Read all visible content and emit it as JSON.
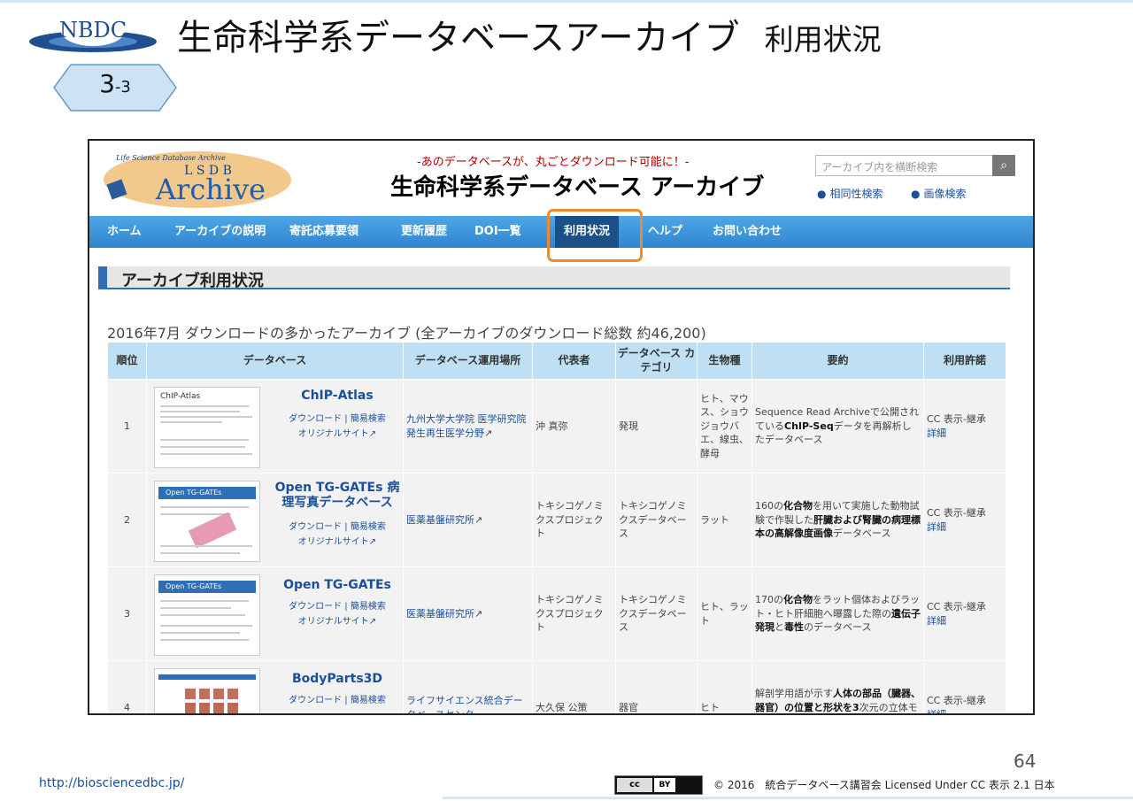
{
  "slide": {
    "logo_text": "NBDC",
    "title": "生命科学系データベースアーカイブ",
    "title_sub": "利用状況",
    "badge_main": "3",
    "badge_sub": "-3",
    "page_number": "64",
    "footer_url": "http://biosciencedbc.jp/",
    "cc_label": "cc",
    "by_label": "BY",
    "copyright": "© 2016　統合データベース講習会 Licensed Under CC 表示 2.1 日本"
  },
  "site": {
    "logo_line1": "Life Science Database Archive",
    "logo_line2": "L S D B",
    "logo_line3": "Archive",
    "tagline": "-あのデータベースが、丸ごとダウンロード可能に！-",
    "title": "生命科学系データベース アーカイブ",
    "search_placeholder": "アーカイブ内を横断検索",
    "search_links": [
      "相同性検索",
      "画像検索"
    ],
    "nav": [
      "ホーム",
      "アーカイブの説明",
      "寄託応募要領",
      "更新履歴",
      "DOI一覧",
      "利用状況",
      "ヘルプ",
      "お問い合わせ"
    ],
    "section_title": "アーカイブ利用状況",
    "caption": "2016年7月 ダウンロードの多かったアーカイブ (全アーカイブのダウンロード総数 約46,200)"
  },
  "table": {
    "headers": [
      "順位",
      "データベース",
      "データベース運用場所",
      "代表者",
      "データベース カテゴリ",
      "生物種",
      "要約",
      "利用許諾"
    ],
    "link_download": "ダウンロード",
    "link_search": "簡易検索",
    "link_original": "オリジナルサイト",
    "license": "CC 表示-継承",
    "details": "詳細",
    "rows": [
      {
        "rank": "1",
        "name": "ChIP-Atlas",
        "thumb_title": "ChIP-Atlas",
        "location": "九州大学大学院 医学研究院 発生再生医学分野",
        "rep": "沖 真弥",
        "category": "発現",
        "species": "ヒト、マウス、ショウジョウバエ、線虫、酵母",
        "summary_a": "Sequence Read Archiveで公開されている",
        "summary_b": "ChIP-Seq",
        "summary_c": "データを再解析したデータベース"
      },
      {
        "rank": "2",
        "name": "Open TG-GATEs 病理写真データベース",
        "thumb_title": "Open TG-GATEs",
        "location": "医薬基盤研究所",
        "rep": "トキシコゲノミクスプロジェクト",
        "category": "トキシコゲノミクスデータベース",
        "species": "ラット",
        "summary_a": "160の",
        "summary_b": "化合物",
        "summary_c": "を用いて実施した動物試験で作製した",
        "summary_d": "肝臓および腎臓の病理標本の高解像度画像",
        "summary_e": "データベース"
      },
      {
        "rank": "3",
        "name": "Open TG-GATEs",
        "thumb_title": "Open TG-GATEs",
        "location": "医薬基盤研究所",
        "rep": "トキシコゲノミクスプロジェクト",
        "category": "トキシコゲノミクスデータベース",
        "species": "ヒト、ラット",
        "summary_a": "170の",
        "summary_b": "化合物",
        "summary_c": "をラット個体およびラット・ヒト肝細胞へ曝露した際の",
        "summary_d": "遺伝子発現",
        "summary_e": "と",
        "summary_f": "毒性",
        "summary_g": "のデータベース"
      },
      {
        "rank": "4",
        "name": "BodyParts3D",
        "location": "ライフサイエンス統合データベースセンター",
        "rep": "大久保 公策",
        "category": "器官",
        "species": "ヒト",
        "summary_a": "解剖学用語が示す",
        "summary_b": "人体の部品（臓器、器官）の位置と形状を3",
        "summary_c": "次元の立体モデルで表現"
      }
    ]
  }
}
